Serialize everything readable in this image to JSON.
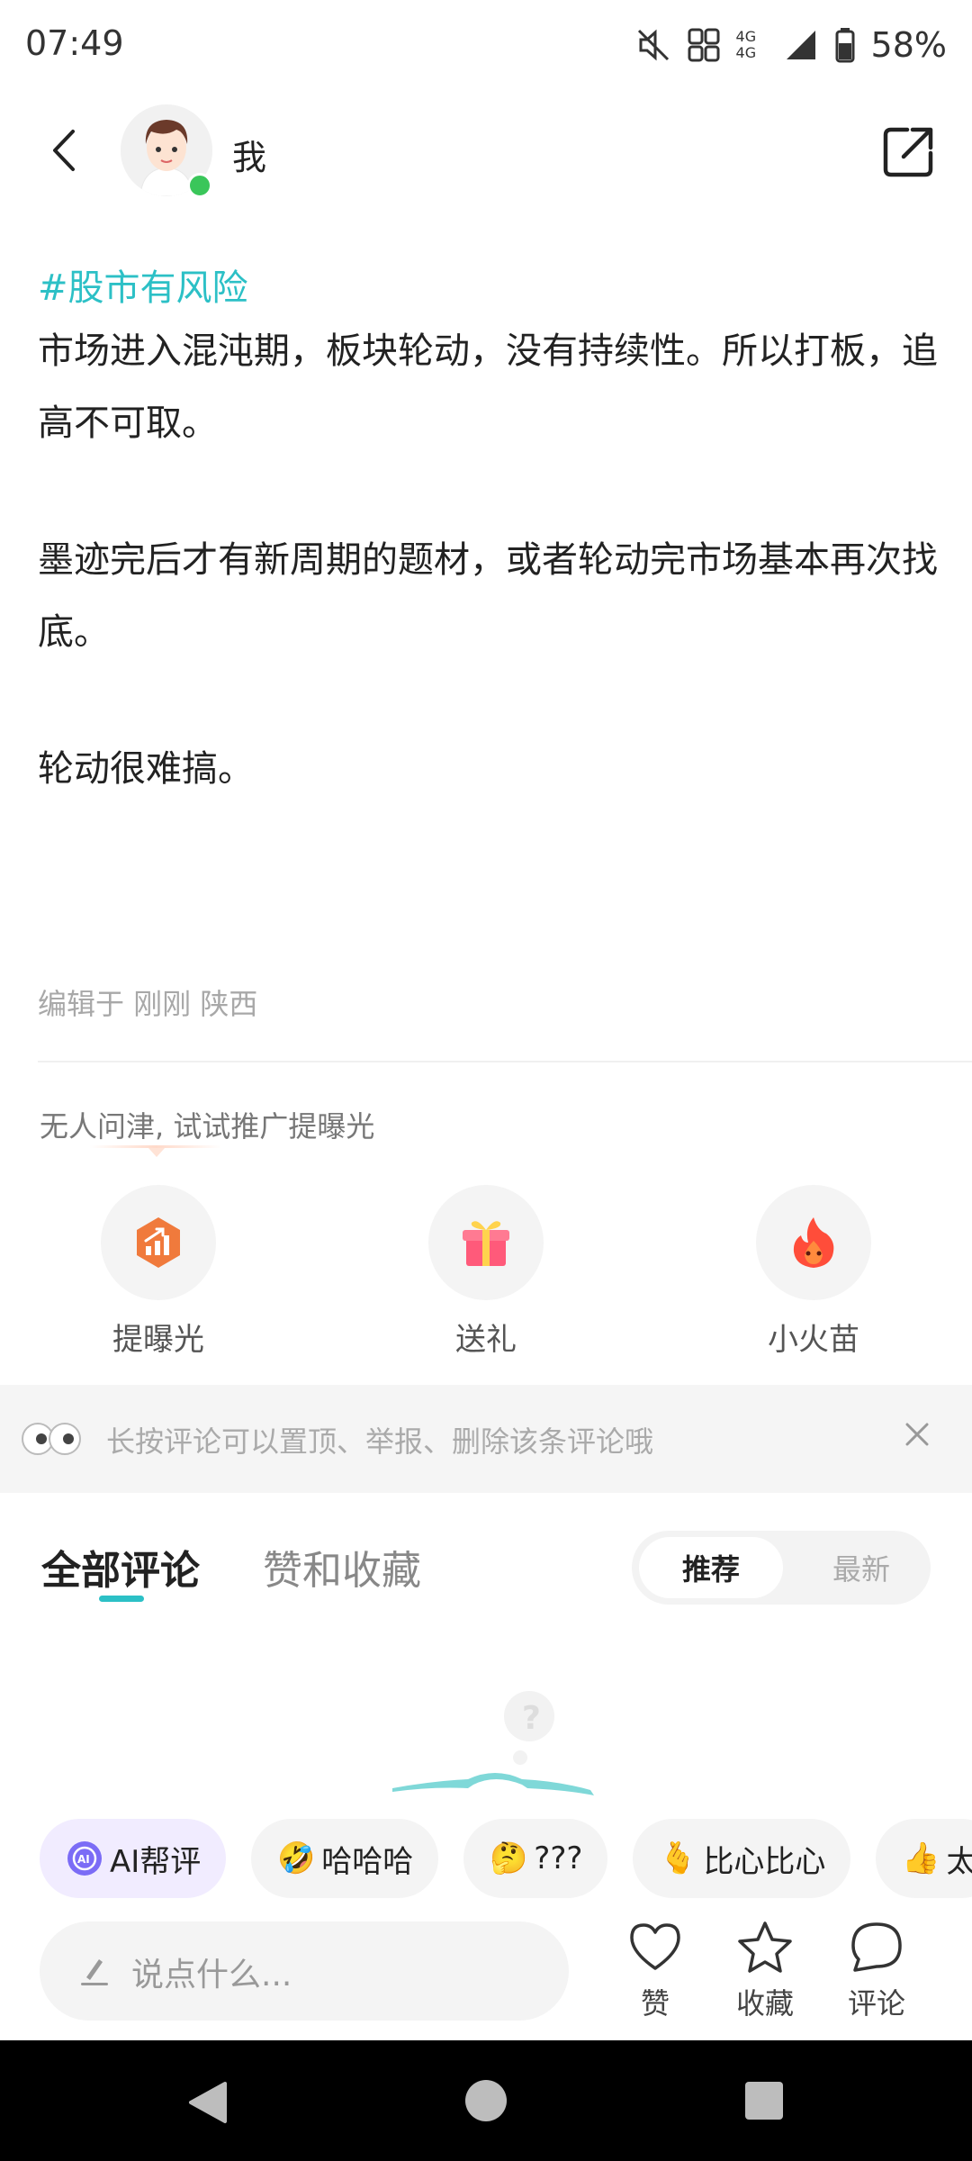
{
  "status_bar": {
    "time": "07:49",
    "network": "4G 4G",
    "battery": "58%"
  },
  "header": {
    "username": "我"
  },
  "post": {
    "hashtag": "#股市有风险",
    "paragraphs": [
      "市场进入混沌期，板块轮动，没有持续性。所以打板，追高不可取。",
      "墨迹完后才有新周期的题材，或者轮动完市场基本再次找底。",
      "轮动很难搞。"
    ],
    "edit_meta": "编辑于 刚刚 陕西"
  },
  "promotion": {
    "hint": "无人问津, 试试推广提曝光",
    "actions": [
      {
        "label": "提曝光",
        "icon": "boost-icon"
      },
      {
        "label": "送礼",
        "icon": "gift-icon"
      },
      {
        "label": "小火苗",
        "icon": "flame-icon"
      }
    ]
  },
  "tip": {
    "text": "长按评论可以置顶、举报、删除该条评论哦"
  },
  "tabs": {
    "all_comments": "全部评论",
    "likes_favorites": "赞和收藏",
    "sort_recommended": "推荐",
    "sort_latest": "最新"
  },
  "quick_replies": [
    {
      "label": "AI帮评",
      "icon": "ai-icon"
    },
    {
      "label": "哈哈哈",
      "icon": "🤣"
    },
    {
      "label": "???",
      "icon": "🤔"
    },
    {
      "label": "比心比心",
      "icon": "🫰"
    },
    {
      "label": "太",
      "icon": "👍"
    }
  ],
  "bottom_bar": {
    "input_placeholder": "说点什么...",
    "like_label": "赞",
    "favorite_label": "收藏",
    "comment_label": "评论"
  },
  "colors": {
    "accent": "#2cc0c6",
    "online": "#3ac65a"
  }
}
